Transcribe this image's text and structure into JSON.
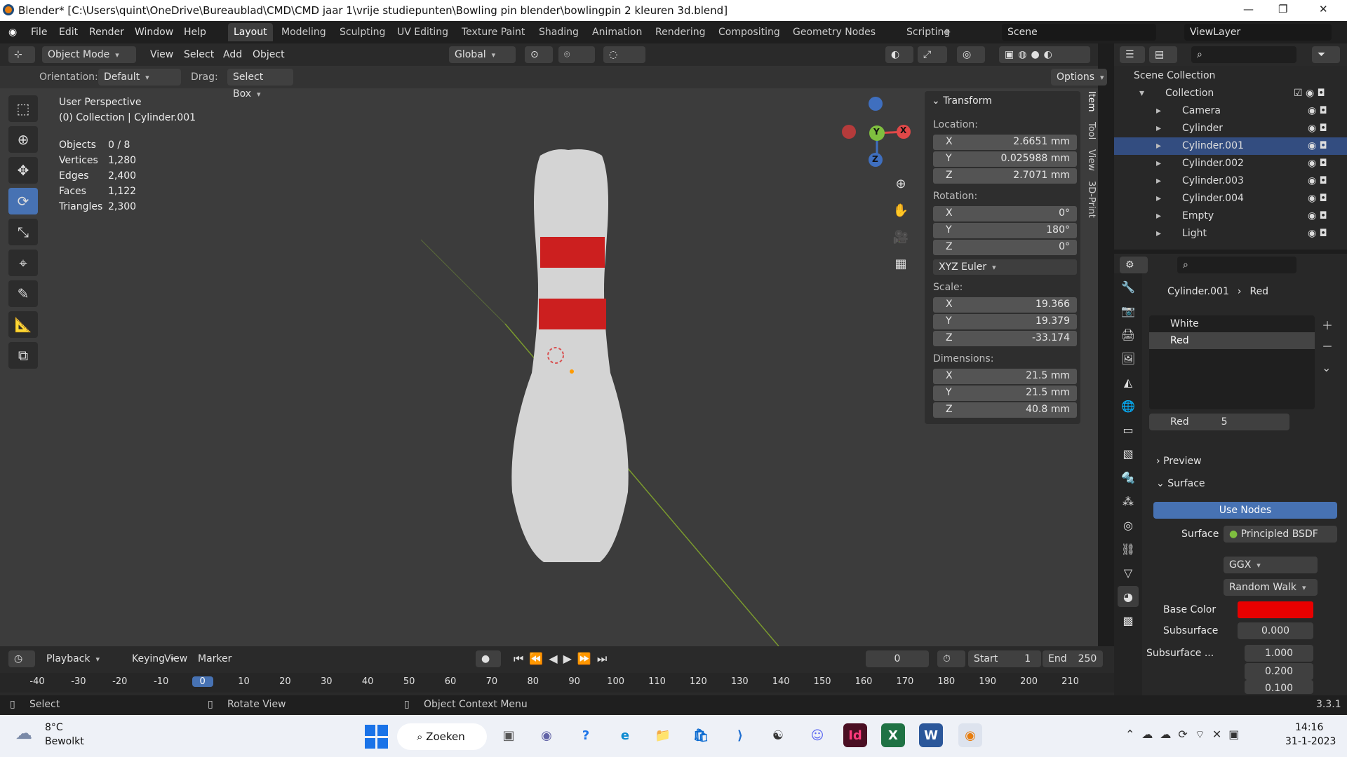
{
  "window": {
    "title": "Blender* [C:\\Users\\quint\\OneDrive\\Bureaublad\\CMD\\CMD jaar 1\\vrije studiepunten\\Bowling pin blender\\bowlingpin 2 kleuren 3d.blend]",
    "min": "—",
    "max": "❐",
    "close": "✕"
  },
  "menu": [
    "File",
    "Edit",
    "Render",
    "Window",
    "Help"
  ],
  "workspaces": [
    "Layout",
    "Modeling",
    "Sculpting",
    "UV Editing",
    "Texture Paint",
    "Shading",
    "Animation",
    "Rendering",
    "Compositing",
    "Geometry Nodes",
    "Scripting",
    "+"
  ],
  "scene": "Scene",
  "viewlayer": "ViewLayer",
  "vp": {
    "mode": "Object Mode",
    "view": "View",
    "select": "Select",
    "add": "Add",
    "object": "Object",
    "transform": "Global",
    "orientation_label": "Orientation:",
    "orientation": "Default",
    "drag_label": "Drag:",
    "drag": "Select Box",
    "options": "Options"
  },
  "overlay": {
    "perspective": "User Perspective",
    "collection": "(0) Collection | Cylinder.001"
  },
  "stats": [
    {
      "k": "Objects",
      "v": "0 / 8"
    },
    {
      "k": "Vertices",
      "v": "1,280"
    },
    {
      "k": "Edges",
      "v": "2,400"
    },
    {
      "k": "Faces",
      "v": "1,122"
    },
    {
      "k": "Triangles",
      "v": "2,300"
    }
  ],
  "npanel": {
    "title": "Transform",
    "location": "Location:",
    "rotation": "Rotation:",
    "scale": "Scale:",
    "dimensions": "Dimensions:",
    "euler": "XYZ Euler",
    "loc": [
      {
        "ax": "X",
        "v": "2.6651 mm"
      },
      {
        "ax": "Y",
        "v": "0.025988 mm"
      },
      {
        "ax": "Z",
        "v": "2.7071 mm"
      }
    ],
    "rot": [
      {
        "ax": "X",
        "v": "0°"
      },
      {
        "ax": "Y",
        "v": "180°"
      },
      {
        "ax": "Z",
        "v": "0°"
      }
    ],
    "scl": [
      {
        "ax": "X",
        "v": "19.366"
      },
      {
        "ax": "Y",
        "v": "19.379"
      },
      {
        "ax": "Z",
        "v": "-33.174"
      }
    ],
    "dim": [
      {
        "ax": "X",
        "v": "21.5 mm"
      },
      {
        "ax": "Y",
        "v": "21.5 mm"
      },
      {
        "ax": "Z",
        "v": "40.8 mm"
      }
    ],
    "tabs": [
      "Item",
      "Tool",
      "View",
      "3D-Print"
    ]
  },
  "gizmo": {
    "x": "X",
    "y": "Y",
    "z": "Z"
  },
  "outliner": {
    "root": "Scene Collection",
    "collection": "Collection",
    "items": [
      "Camera",
      "Cylinder",
      "Cylinder.001",
      "Cylinder.002",
      "Cylinder.003",
      "Cylinder.004",
      "Empty",
      "Light"
    ]
  },
  "props": {
    "object": "Cylinder.001",
    "material": "Red",
    "slots": [
      "White",
      "Red"
    ],
    "mat_name": "Red",
    "users": "5",
    "preview": "Preview",
    "surface": "Surface",
    "use_nodes": "Use Nodes",
    "surface_label": "Surface",
    "shader": "Principled BSDF",
    "dist": "GGX",
    "sss_method": "Random Walk",
    "base_color_label": "Base Color",
    "base_color": "#e80000",
    "subsurface_label": "Subsurface",
    "subsurface": "0.000",
    "sss_radius_label": "Subsurface ...",
    "sss_r": "1.000",
    "sss_g": "0.200",
    "sss_b": "0.100"
  },
  "timeline": {
    "playback": "Playback",
    "keying": "Keying",
    "view": "View",
    "marker": "Marker",
    "frame": "0",
    "start_label": "Start",
    "start": "1",
    "end_label": "End",
    "end": "250",
    "ticks": [
      "-40",
      "-30",
      "-20",
      "-10",
      "0",
      "10",
      "20",
      "30",
      "40",
      "50",
      "60",
      "70",
      "80",
      "90",
      "100",
      "110",
      "120",
      "130",
      "140",
      "150",
      "160",
      "170",
      "180",
      "190",
      "200",
      "210"
    ]
  },
  "status": {
    "select": "Select",
    "rotate": "Rotate View",
    "context": "Object Context Menu",
    "version": "3.3.1"
  },
  "taskbar": {
    "temp": "8°C",
    "weather": "Bewolkt",
    "search": "Zoeken",
    "time": "14:16",
    "date": "31-1-2023"
  }
}
